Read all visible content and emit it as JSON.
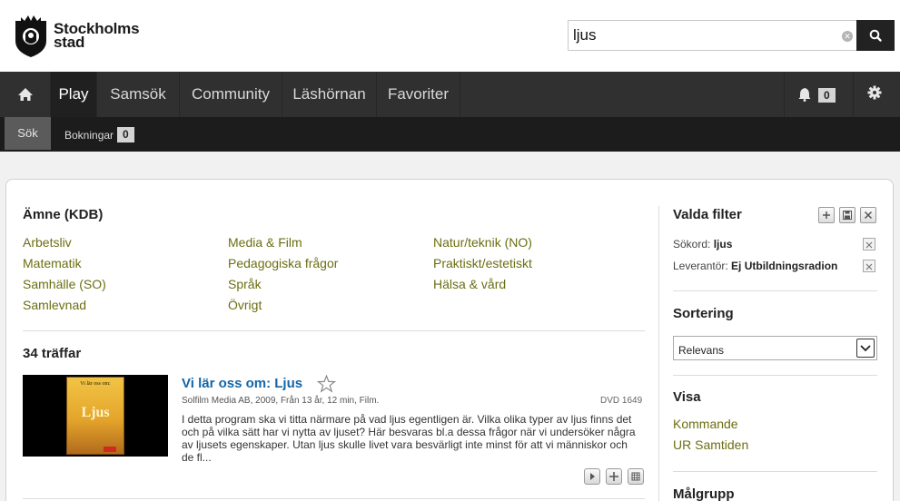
{
  "brand": {
    "line1": "Stockholms",
    "line2": "stad"
  },
  "search": {
    "value": "ljus",
    "placeholder": ""
  },
  "nav": {
    "items": [
      "Play",
      "Samsök",
      "Community",
      "Läshörnan",
      "Favoriter"
    ],
    "notification_count": "0"
  },
  "subnav": {
    "sok": "Sök",
    "bokningar": "Bokningar",
    "bokningar_count": "0"
  },
  "subjects": {
    "title": "Ämne (KDB)",
    "col1": [
      "Arbetsliv",
      "Matematik",
      "Samhälle (SO)",
      "Samlevnad"
    ],
    "col2": [
      "Media & Film",
      "Pedagogiska frågor",
      "Språk",
      "Övrigt"
    ],
    "col3": [
      "Natur/teknik (NO)",
      "Praktiskt/estetiskt",
      "Hälsa & vård"
    ]
  },
  "results": {
    "count_label": "34 träffar",
    "items": [
      {
        "title": "Vi lär oss om: Ljus",
        "meta": "Solfilm Media AB, 2009, Från 13 år, 12 min, Film.",
        "code": "DVD 1649",
        "description": "I detta program ska vi titta närmare på vad ljus egentligen är. Vilka olika typer av ljus finns det och på vilka sätt har vi nytta av ljuset? Här besvaras bl.a dessa frågor när vi undersöker några av ljusets egenskaper. Utan ljus skulle livet vara besvärligt inte minst för att vi människor och de fl...",
        "cover_title": "Vi lär oss om:",
        "cover_word": "Ljus"
      }
    ]
  },
  "sidebar": {
    "valda_filter": "Valda filter",
    "filters": [
      {
        "label": "Sökord:",
        "value": "ljus"
      },
      {
        "label": "Leverantör:",
        "value": "Ej Utbildningsradion"
      }
    ],
    "sortering": "Sortering",
    "sort_value": "Relevans",
    "visa": "Visa",
    "visa_items": [
      "Kommande",
      "UR Samtiden"
    ],
    "malgrupp": "Målgrupp"
  },
  "colors": {
    "link": "#6c6e12",
    "title_link": "#1465a8",
    "nav_bg": "#303030"
  }
}
